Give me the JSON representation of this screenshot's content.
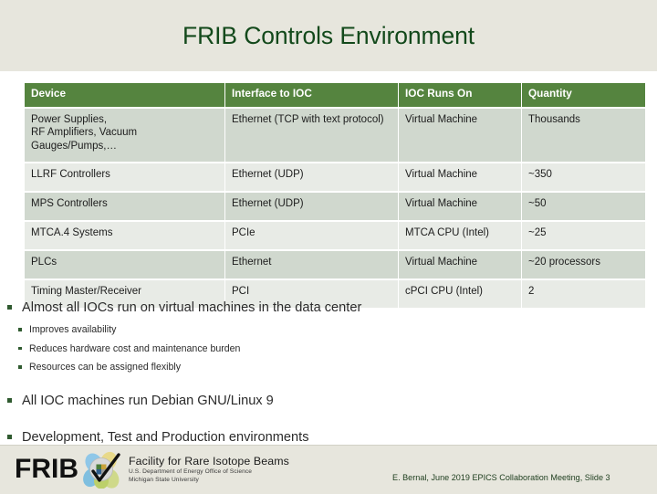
{
  "slide": {
    "title": "FRIB Controls Environment",
    "title_color": "#13491b",
    "band_color": "#e7e6dd",
    "body_background": "#ffffff"
  },
  "table": {
    "header_color": "#55843f",
    "row_dark_color": "#d0d8ce",
    "row_light_color": "#e8ebe6",
    "columns": [
      "Device",
      "Interface to IOC",
      "IOC Runs On",
      "Quantity"
    ],
    "rows": [
      {
        "device": "Power Supplies, RF Amplifiers, Vacuum Gauges/Pumps,…",
        "device_lines": [
          "Power Supplies,",
          "RF Amplifiers, Vacuum",
          "Gauges/Pumps,…"
        ],
        "interface": "Ethernet (TCP with text protocol)",
        "runs_on": "Virtual Machine",
        "quantity": "Thousands"
      },
      {
        "device": "LLRF Controllers",
        "interface": "Ethernet (UDP)",
        "runs_on": "Virtual Machine",
        "quantity": "~350"
      },
      {
        "device": "MPS Controllers",
        "interface": "Ethernet (UDP)",
        "runs_on": "Virtual Machine",
        "quantity": "~50"
      },
      {
        "device": "MTCA.4 Systems",
        "interface": "PCIe",
        "runs_on": "MTCA CPU (Intel)",
        "quantity": "~25"
      },
      {
        "device": "PLCs",
        "interface": "Ethernet",
        "runs_on": "Virtual Machine",
        "quantity": "~20 processors"
      },
      {
        "device": "Timing Master/Receiver",
        "interface": "PCI",
        "runs_on": "cPCI CPU (Intel)",
        "quantity": "2"
      }
    ]
  },
  "bullets": {
    "bullet_color": "#2f5a2f",
    "items": [
      {
        "text": "Almost all IOCs run on virtual machines in the data center",
        "sub": [
          "Improves availability",
          "Reduces hardware cost and maintenance burden",
          "Resources can be assigned flexibly"
        ]
      },
      {
        "text": "All IOC machines run Debian GNU/Linux 9",
        "sub": []
      },
      {
        "text": "Development, Test and Production environments",
        "sub": []
      }
    ]
  },
  "footer": {
    "logo_wordmark": "FRIB",
    "logo_line1": "Facility for Rare Isotope Beams",
    "logo_line2": "U.S. Department of Energy Office of Science",
    "logo_line3": "Michigan State University",
    "credit": "E. Bernal, June 2019 EPICS Collaboration Meeting, Slide 3",
    "background": "#e7e6dd"
  }
}
